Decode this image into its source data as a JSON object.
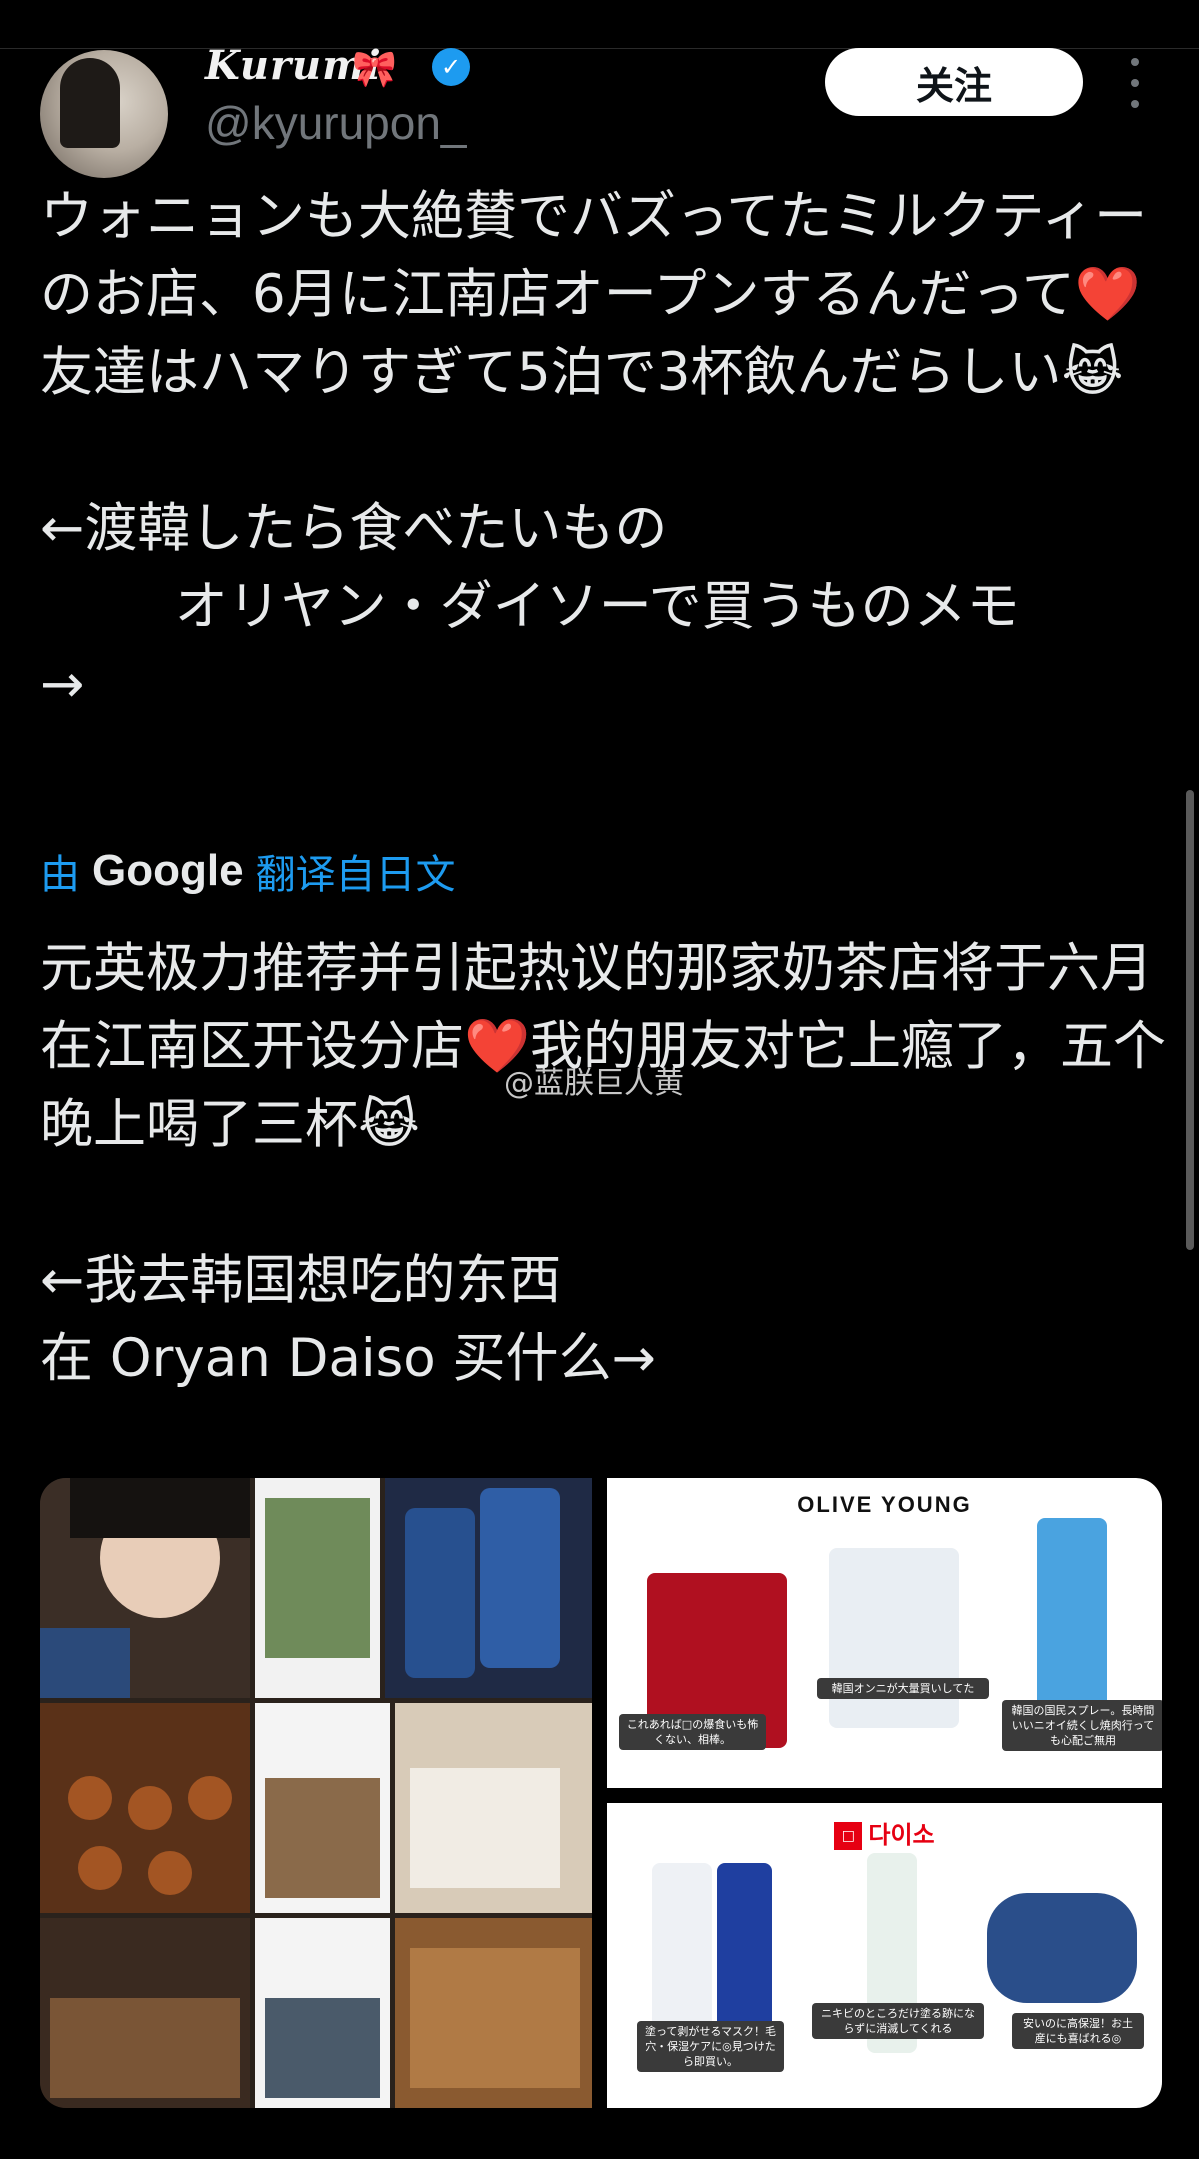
{
  "author": {
    "display_name": "Kurumi",
    "handle": "@kyurupon_",
    "follow_label": "关注"
  },
  "post": {
    "original_text": "ウォニョンも大絶賛でバズってたミルクティーのお店、6月に江南店オープンするんだって❤️友達はハマりすぎて5泊で3杯飲んだらしい😹\n\n←渡韓したら食べたいもの\n        オリヤン・ダイソーで買うものメモ\n→",
    "translate_prefix": "由",
    "translate_brand": "Google",
    "translate_suffix": "翻译自日文",
    "translated_text": "元英极力推荐并引起热议的那家奶茶店将于六月在江南区开设分店❤️我的朋友对它上瘾了，五个晚上喝了三杯😹\n\n←我去韩国想吃的东西\n在 Oryan Daiso 买什么→",
    "watermark": "@蓝朕巨人黄"
  },
  "media": {
    "olive_brand": "OLIVE YOUNG",
    "olive_captions": [
      "これあれば□の爆食いも怖くない、相棒。",
      "韓国オンニが大量買いしてた",
      "韓国の国民スプレー。長時間いいニオイ続くし焼肉行っても心配ご無用"
    ],
    "daiso_brand": "다이소",
    "daiso_captions": [
      "塗って剥がせるマスク！毛穴・保湿ケアに◎見つけたら即買い。",
      "ニキビのところだけ塗る跡にならずに消滅してくれる",
      "安いのに高保湿！お土産にも喜ばれる◎"
    ]
  },
  "colors": {
    "accent": "#1d9bf0",
    "background": "#000000",
    "text": "#e7e9ea",
    "muted": "#71767b"
  }
}
